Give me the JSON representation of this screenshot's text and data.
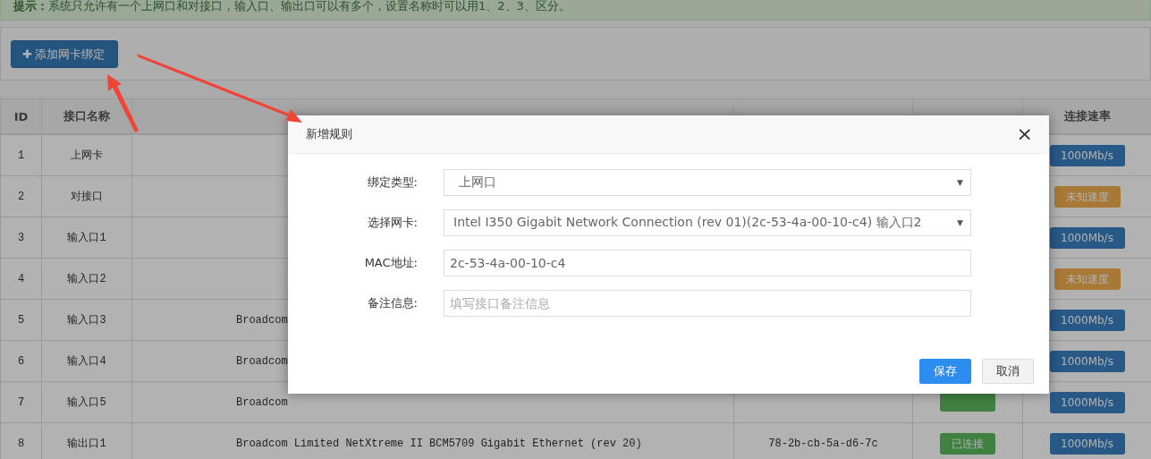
{
  "tip": "**提示：**系统只允许有一个上网口和对接口，输入口、输出口可以有多个，设置名称时可以用1、2、3、区分。",
  "add_button": {
    "icon": "✚",
    "label": "添加网卡绑定"
  },
  "table": {
    "columns": [
      {
        "label": "ID"
      },
      {
        "label": "接口名称"
      },
      {},
      {},
      {},
      {
        "label": "连接速率"
      }
    ],
    "rows": [
      {
        "id": "1",
        "name": "上网卡",
        "speed": {
          "kind": "known",
          "text": "1000Mb/s"
        }
      },
      {
        "id": "2",
        "name": "对接口",
        "speed": {
          "kind": "unknown",
          "text": "未知速度"
        }
      },
      {
        "id": "3",
        "name": "输入口1",
        "speed": {
          "kind": "known",
          "text": "1000Mb/s"
        }
      },
      {
        "id": "4",
        "name": "输入口2",
        "speed": {
          "kind": "unknown",
          "text": "未知速度"
        }
      },
      {
        "id": "5",
        "name": "输入口3",
        "nic": "Broadcom",
        "speed": {
          "kind": "known",
          "text": "1000Mb/s"
        }
      },
      {
        "id": "6",
        "name": "输入口4",
        "nic": "Broadcom",
        "speed": {
          "kind": "known",
          "text": "1000Mb/s"
        }
      },
      {
        "id": "7",
        "name": "输入口5",
        "nic": "Broadcom",
        "status": {
          "kind": "connected"
        },
        "speed": {
          "kind": "known",
          "text": "1000Mb/s"
        }
      },
      {
        "id": "8",
        "name": "输出口1",
        "nic": "Broadcom Limited NetXtreme II BCM5709 Gigabit Ethernet (rev 20)",
        "mac": "78-2b-cb-5a-d6-7c",
        "status": {
          "kind": "connected",
          "text": "已连接"
        },
        "speed": {
          "kind": "known",
          "text": "1000Mb/s"
        }
      }
    ]
  },
  "dialog": {
    "title": "新增规则",
    "close": "×",
    "fields": [
      {
        "kind": "select",
        "label": "绑定类型:",
        "value": "上网口",
        "caret": "▼"
      },
      {
        "kind": "select",
        "label": "选择网卡:",
        "value": "Intel I350 Gigabit Network Connection (rev 01)(2c-53-4a-00-10-c4) 输入口2",
        "caret": "▼"
      },
      {
        "kind": "input",
        "label": "MAC地址:",
        "value": "2c-53-4a-00-10-c4"
      },
      {
        "kind": "input",
        "label": "备注信息:",
        "placeholder": "填写接口备注信息"
      }
    ],
    "buttons": [
      {
        "kind": "primary",
        "label": "保存"
      },
      {
        "kind": "default",
        "label": "取消"
      }
    ]
  }
}
